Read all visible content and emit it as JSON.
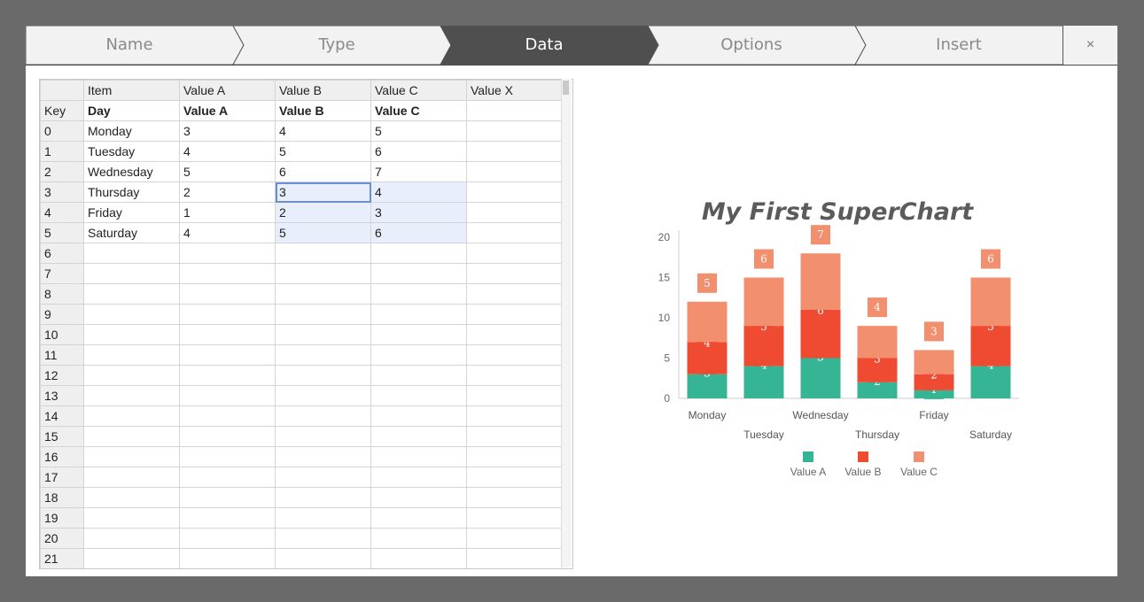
{
  "wizard": {
    "steps": [
      {
        "label": "Name"
      },
      {
        "label": "Type"
      },
      {
        "label": "Data"
      },
      {
        "label": "Options"
      },
      {
        "label": "Insert"
      }
    ],
    "active_step": 2,
    "close_label": "×",
    "colors": {
      "active": "#4f4f4f",
      "inactive": "#f2f2f2"
    }
  },
  "sheet": {
    "header_row": [
      "",
      "Item",
      "Value A",
      "Value B",
      "Value C",
      "Value X"
    ],
    "key_row": [
      "Key",
      "Day",
      "Value A",
      "Value B",
      "Value C",
      ""
    ],
    "rows": [
      [
        "0",
        "Monday",
        "3",
        "4",
        "5",
        ""
      ],
      [
        "1",
        "Tuesday",
        "4",
        "5",
        "6",
        ""
      ],
      [
        "2",
        "Wednesday",
        "5",
        "6",
        "7",
        ""
      ],
      [
        "3",
        "Thursday",
        "2",
        "3",
        "4",
        ""
      ],
      [
        "4",
        "Friday",
        "1",
        "2",
        "3",
        ""
      ],
      [
        "5",
        "Saturday",
        "4",
        "5",
        "6",
        ""
      ],
      [
        "6",
        "",
        "",
        "",
        "",
        ""
      ],
      [
        "7",
        "",
        "",
        "",
        "",
        ""
      ],
      [
        "8",
        "",
        "",
        "",
        "",
        ""
      ],
      [
        "9",
        "",
        "",
        "",
        "",
        ""
      ],
      [
        "10",
        "",
        "",
        "",
        "",
        ""
      ],
      [
        "11",
        "",
        "",
        "",
        "",
        ""
      ],
      [
        "12",
        "",
        "",
        "",
        "",
        ""
      ],
      [
        "13",
        "",
        "",
        "",
        "",
        ""
      ],
      [
        "14",
        "",
        "",
        "",
        "",
        ""
      ],
      [
        "15",
        "",
        "",
        "",
        "",
        ""
      ],
      [
        "16",
        "",
        "",
        "",
        "",
        ""
      ],
      [
        "17",
        "",
        "",
        "",
        "",
        ""
      ],
      [
        "18",
        "",
        "",
        "",
        "",
        ""
      ],
      [
        "19",
        "",
        "",
        "",
        "",
        ""
      ],
      [
        "20",
        "",
        "",
        "",
        "",
        ""
      ],
      [
        "21",
        "",
        "",
        "",
        "",
        ""
      ]
    ],
    "active_cell": "C3"
  },
  "chart_data": {
    "type": "bar",
    "stacked": true,
    "title": "My First SuperChart",
    "categories": [
      "Monday",
      "Tuesday",
      "Wednesday",
      "Thursday",
      "Friday",
      "Saturday"
    ],
    "series": [
      {
        "name": "Value A",
        "color": "#35b594",
        "values": [
          3,
          4,
          5,
          2,
          1,
          4
        ]
      },
      {
        "name": "Value B",
        "color": "#ef4b32",
        "values": [
          4,
          5,
          6,
          3,
          2,
          5
        ]
      },
      {
        "name": "Value C",
        "color": "#f28f6e",
        "values": [
          5,
          6,
          7,
          4,
          3,
          6
        ]
      }
    ],
    "ylim": [
      0,
      20
    ],
    "yticks": [
      0,
      5,
      10,
      15,
      20
    ],
    "xlabel": "",
    "ylabel": "",
    "legend": "bottom",
    "data_labels": true
  }
}
